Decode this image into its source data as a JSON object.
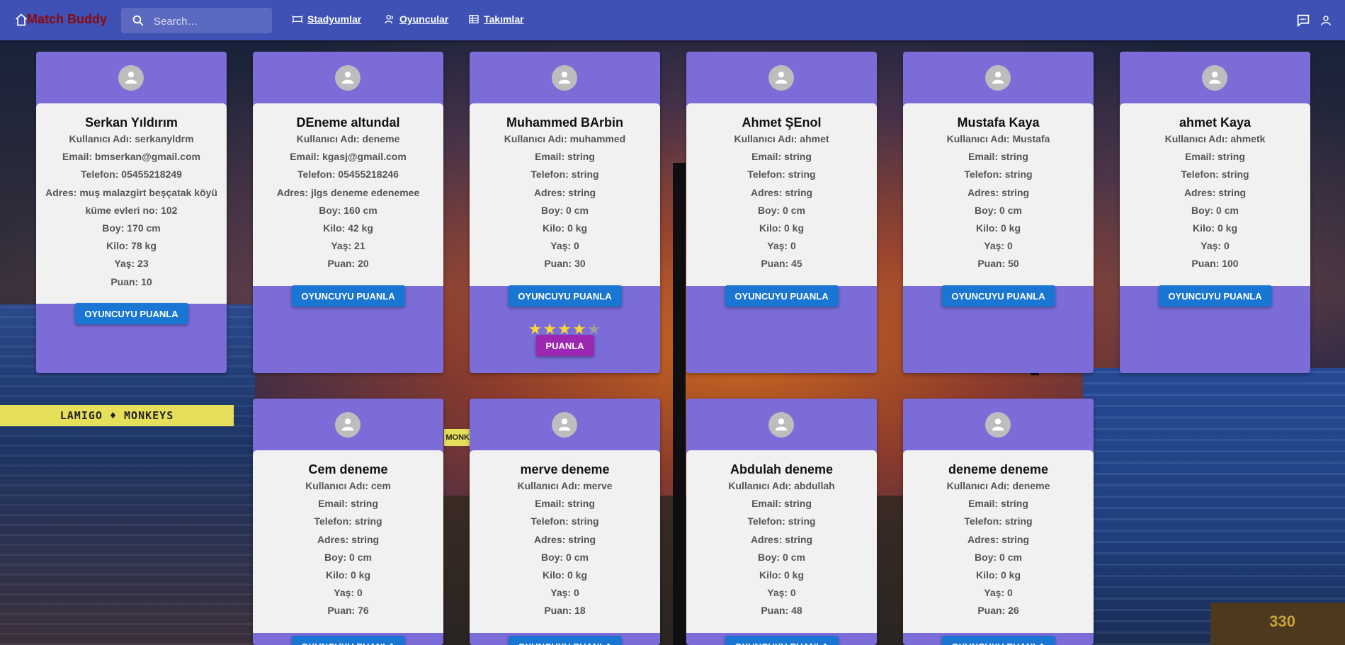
{
  "header": {
    "brand": "Match Buddy",
    "search_placeholder": "Search…",
    "nav": [
      {
        "label": "Stadyumlar",
        "icon": "stadium-icon"
      },
      {
        "label": "Oyuncular",
        "icon": "players-icon"
      },
      {
        "label": "Takımlar",
        "icon": "teams-icon"
      }
    ]
  },
  "background": {
    "banner_text": "LAMIGO ♦ MONKEYS",
    "banner2_text": "MONK",
    "scoreboard_number": "330"
  },
  "rate_button_label": "OYUNCUYU PUANLA",
  "rating_widget": {
    "stars_filled": 4,
    "stars_total": 5,
    "submit_label": "PUANLA"
  },
  "players": [
    {
      "name": "Serkan Yıldırım",
      "lines": [
        "Kullanıcı Adı: serkanyldrm",
        "Email: bmserkan@gmail.com",
        "Telefon: 05455218249",
        "Adres: muş malazgirt beşçatak köyü küme evleri no: 102",
        "Boy: 170 cm",
        "Kilo: 78 kg",
        "Yaş: 23",
        "Puan: 10"
      ]
    },
    {
      "name": "DEneme altundal",
      "lines": [
        "Kullanıcı Adı: deneme",
        "Email: kgasj@gmail.com",
        "Telefon: 05455218246",
        "Adres: jlgs deneme edenemee",
        "Boy: 160 cm",
        "Kilo: 42 kg",
        "Yaş: 21",
        "Puan: 20"
      ]
    },
    {
      "name": "Muhammed BArbin",
      "lines": [
        "Kullanıcı Adı: muhammed",
        "Email: string",
        "Telefon: string",
        "Adres: string",
        "Boy: 0 cm",
        "Kilo: 0 kg",
        "Yaş: 0",
        "Puan: 30"
      ]
    },
    {
      "name": "Ahmet ŞEnol",
      "lines": [
        "Kullanıcı Adı: ahmet",
        "Email: string",
        "Telefon: string",
        "Adres: string",
        "Boy: 0 cm",
        "Kilo: 0 kg",
        "Yaş: 0",
        "Puan: 45"
      ]
    },
    {
      "name": "Mustafa Kaya",
      "lines": [
        "Kullanıcı Adı: Mustafa",
        "Email: string",
        "Telefon: string",
        "Adres: string",
        "Boy: 0 cm",
        "Kilo: 0 kg",
        "Yaş: 0",
        "Puan: 50"
      ]
    },
    {
      "name": "ahmet Kaya",
      "lines": [
        "Kullanıcı Adı: ahmetk",
        "Email: string",
        "Telefon: string",
        "Adres: string",
        "Boy: 0 cm",
        "Kilo: 0 kg",
        "Yaş: 0",
        "Puan: 100"
      ]
    },
    {
      "name": "Cem deneme",
      "lines": [
        "Kullanıcı Adı: cem",
        "Email: string",
        "Telefon: string",
        "Adres: string",
        "Boy: 0 cm",
        "Kilo: 0 kg",
        "Yaş: 0",
        "Puan: 76"
      ]
    },
    {
      "name": "merve deneme",
      "lines": [
        "Kullanıcı Adı: merve",
        "Email: string",
        "Telefon: string",
        "Adres: string",
        "Boy: 0 cm",
        "Kilo: 0 kg",
        "Yaş: 0",
        "Puan: 18"
      ]
    },
    {
      "name": "Abdulah deneme",
      "lines": [
        "Kullanıcı Adı: abdullah",
        "Email: string",
        "Telefon: string",
        "Adres: string",
        "Boy: 0 cm",
        "Kilo: 0 kg",
        "Yaş: 0",
        "Puan: 48"
      ]
    },
    {
      "name": "deneme deneme",
      "lines": [
        "Kullanıcı Adı: deneme",
        "Email: string",
        "Telefon: string",
        "Adres: string",
        "Boy: 0 cm",
        "Kilo: 0 kg",
        "Yaş: 0",
        "Puan: 26"
      ]
    }
  ]
}
